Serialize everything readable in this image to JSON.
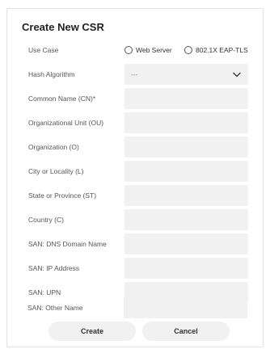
{
  "dialog": {
    "title": "Create New CSR"
  },
  "use_case": {
    "label": "Use Case",
    "options": [
      "Web Server",
      "802.1X EAP-TLS"
    ]
  },
  "hash_algorithm": {
    "label": "Hash Algorithm",
    "value": "---"
  },
  "fields": [
    {
      "label": "Common Name (CN)*",
      "value": ""
    },
    {
      "label": "Organizational Unit (OU)",
      "value": ""
    },
    {
      "label": "Organization (O)",
      "value": ""
    },
    {
      "label": "City or Locality (L)",
      "value": ""
    },
    {
      "label": "State or Province (ST)",
      "value": ""
    },
    {
      "label": "Country (C)",
      "value": ""
    },
    {
      "label": "SAN: DNS Domain Name",
      "value": ""
    },
    {
      "label": "SAN: IP Address",
      "value": ""
    },
    {
      "label": "SAN: UPN",
      "value": ""
    },
    {
      "label": "SAN: Other Name",
      "value": ""
    }
  ],
  "buttons": {
    "create": "Create",
    "cancel": "Cancel"
  },
  "icons": {
    "dropdown": "chevron-down-icon",
    "radio": "radio-unselected-icon"
  },
  "colors": {
    "field_background": "#f1f1f1",
    "border": "#e3e3e3",
    "title_text": "#222222",
    "label_text": "#555555"
  }
}
